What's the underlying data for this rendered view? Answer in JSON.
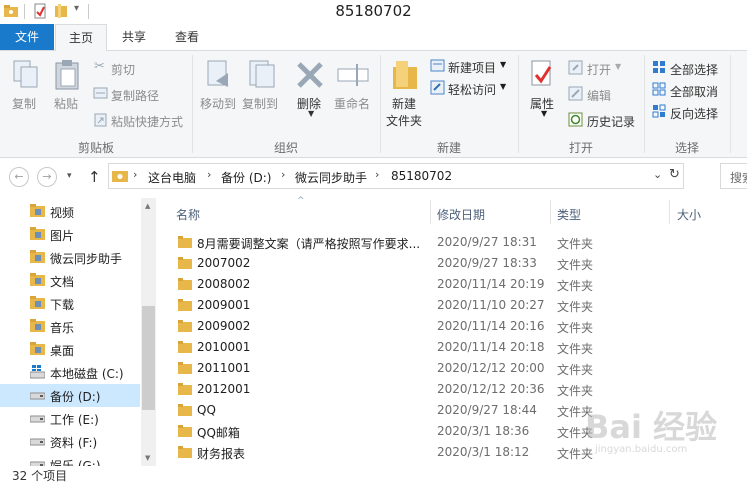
{
  "window": {
    "title": "85180702"
  },
  "ribbon_tabs": [
    "文件",
    "主页",
    "共享",
    "查看"
  ],
  "ribbon": {
    "clipboard": {
      "copy": "复制",
      "paste": "粘贴",
      "cut": "剪切",
      "copy_path": "复制路径",
      "paste_shortcut": "粘贴快捷方式",
      "group": "剪贴板"
    },
    "organize": {
      "move_to": "移动到",
      "copy_to": "复制到",
      "delete": "删除",
      "rename": "重命名",
      "group": "组织"
    },
    "new": {
      "new_folder_l1": "新建",
      "new_folder_l2": "文件夹",
      "new_item": "新建项目",
      "easy_access": "轻松访问",
      "group": "新建"
    },
    "open": {
      "properties": "属性",
      "open": "打开",
      "edit": "编辑",
      "history": "历史记录",
      "group": "打开"
    },
    "select": {
      "select_all": "全部选择",
      "select_none": "全部取消",
      "invert": "反向选择",
      "group": "选择"
    }
  },
  "address": {
    "crumbs": [
      "这台电脑",
      "备份 (D:)",
      "微云同步助手",
      "85180702"
    ],
    "search_placeholder": "搜索"
  },
  "nav_items": [
    {
      "label": "视频",
      "icon": "video-folder-icon"
    },
    {
      "label": "图片",
      "icon": "pictures-folder-icon"
    },
    {
      "label": "微云同步助手",
      "icon": "weiyun-folder-icon"
    },
    {
      "label": "文档",
      "icon": "documents-folder-icon"
    },
    {
      "label": "下载",
      "icon": "downloads-folder-icon"
    },
    {
      "label": "音乐",
      "icon": "music-folder-icon"
    },
    {
      "label": "桌面",
      "icon": "desktop-folder-icon"
    },
    {
      "label": "本地磁盘 (C:)",
      "icon": "windows-drive-icon"
    },
    {
      "label": "备份 (D:)",
      "icon": "drive-icon",
      "selected": true
    },
    {
      "label": "工作 (E:)",
      "icon": "drive-icon"
    },
    {
      "label": "资料 (F:)",
      "icon": "drive-icon"
    },
    {
      "label": "娱乐 (G:)",
      "icon": "drive-icon"
    }
  ],
  "columns": {
    "name": "名称",
    "modified": "修改日期",
    "type": "类型",
    "size": "大小"
  },
  "files": [
    {
      "name": "8月需要调整文案（请严格按照写作要求...",
      "date": "2020/9/27 18:31",
      "type": "文件夹"
    },
    {
      "name": "2007002",
      "date": "2020/9/27 18:33",
      "type": "文件夹"
    },
    {
      "name": "2008002",
      "date": "2020/11/14 20:19",
      "type": "文件夹"
    },
    {
      "name": "2009001",
      "date": "2020/11/10 20:27",
      "type": "文件夹"
    },
    {
      "name": "2009002",
      "date": "2020/11/14 20:16",
      "type": "文件夹"
    },
    {
      "name": "2010001",
      "date": "2020/11/14 20:18",
      "type": "文件夹"
    },
    {
      "name": "2011001",
      "date": "2020/12/12 20:00",
      "type": "文件夹"
    },
    {
      "name": "2012001",
      "date": "2020/12/12 20:36",
      "type": "文件夹"
    },
    {
      "name": "QQ",
      "date": "2020/9/27 18:44",
      "type": "文件夹"
    },
    {
      "name": "QQ邮箱",
      "date": "2020/3/1 18:36",
      "type": "文件夹"
    },
    {
      "name": "财务报表",
      "date": "2020/3/1 18:12",
      "type": "文件夹"
    }
  ],
  "status": {
    "count": "32 个项目"
  },
  "watermark": {
    "text": "Bai 经验",
    "sub": "jingyan.baidu.com"
  },
  "colors": {
    "accent": "#1979ca",
    "folder": "#e8b74a",
    "selection": "#cce8ff"
  }
}
